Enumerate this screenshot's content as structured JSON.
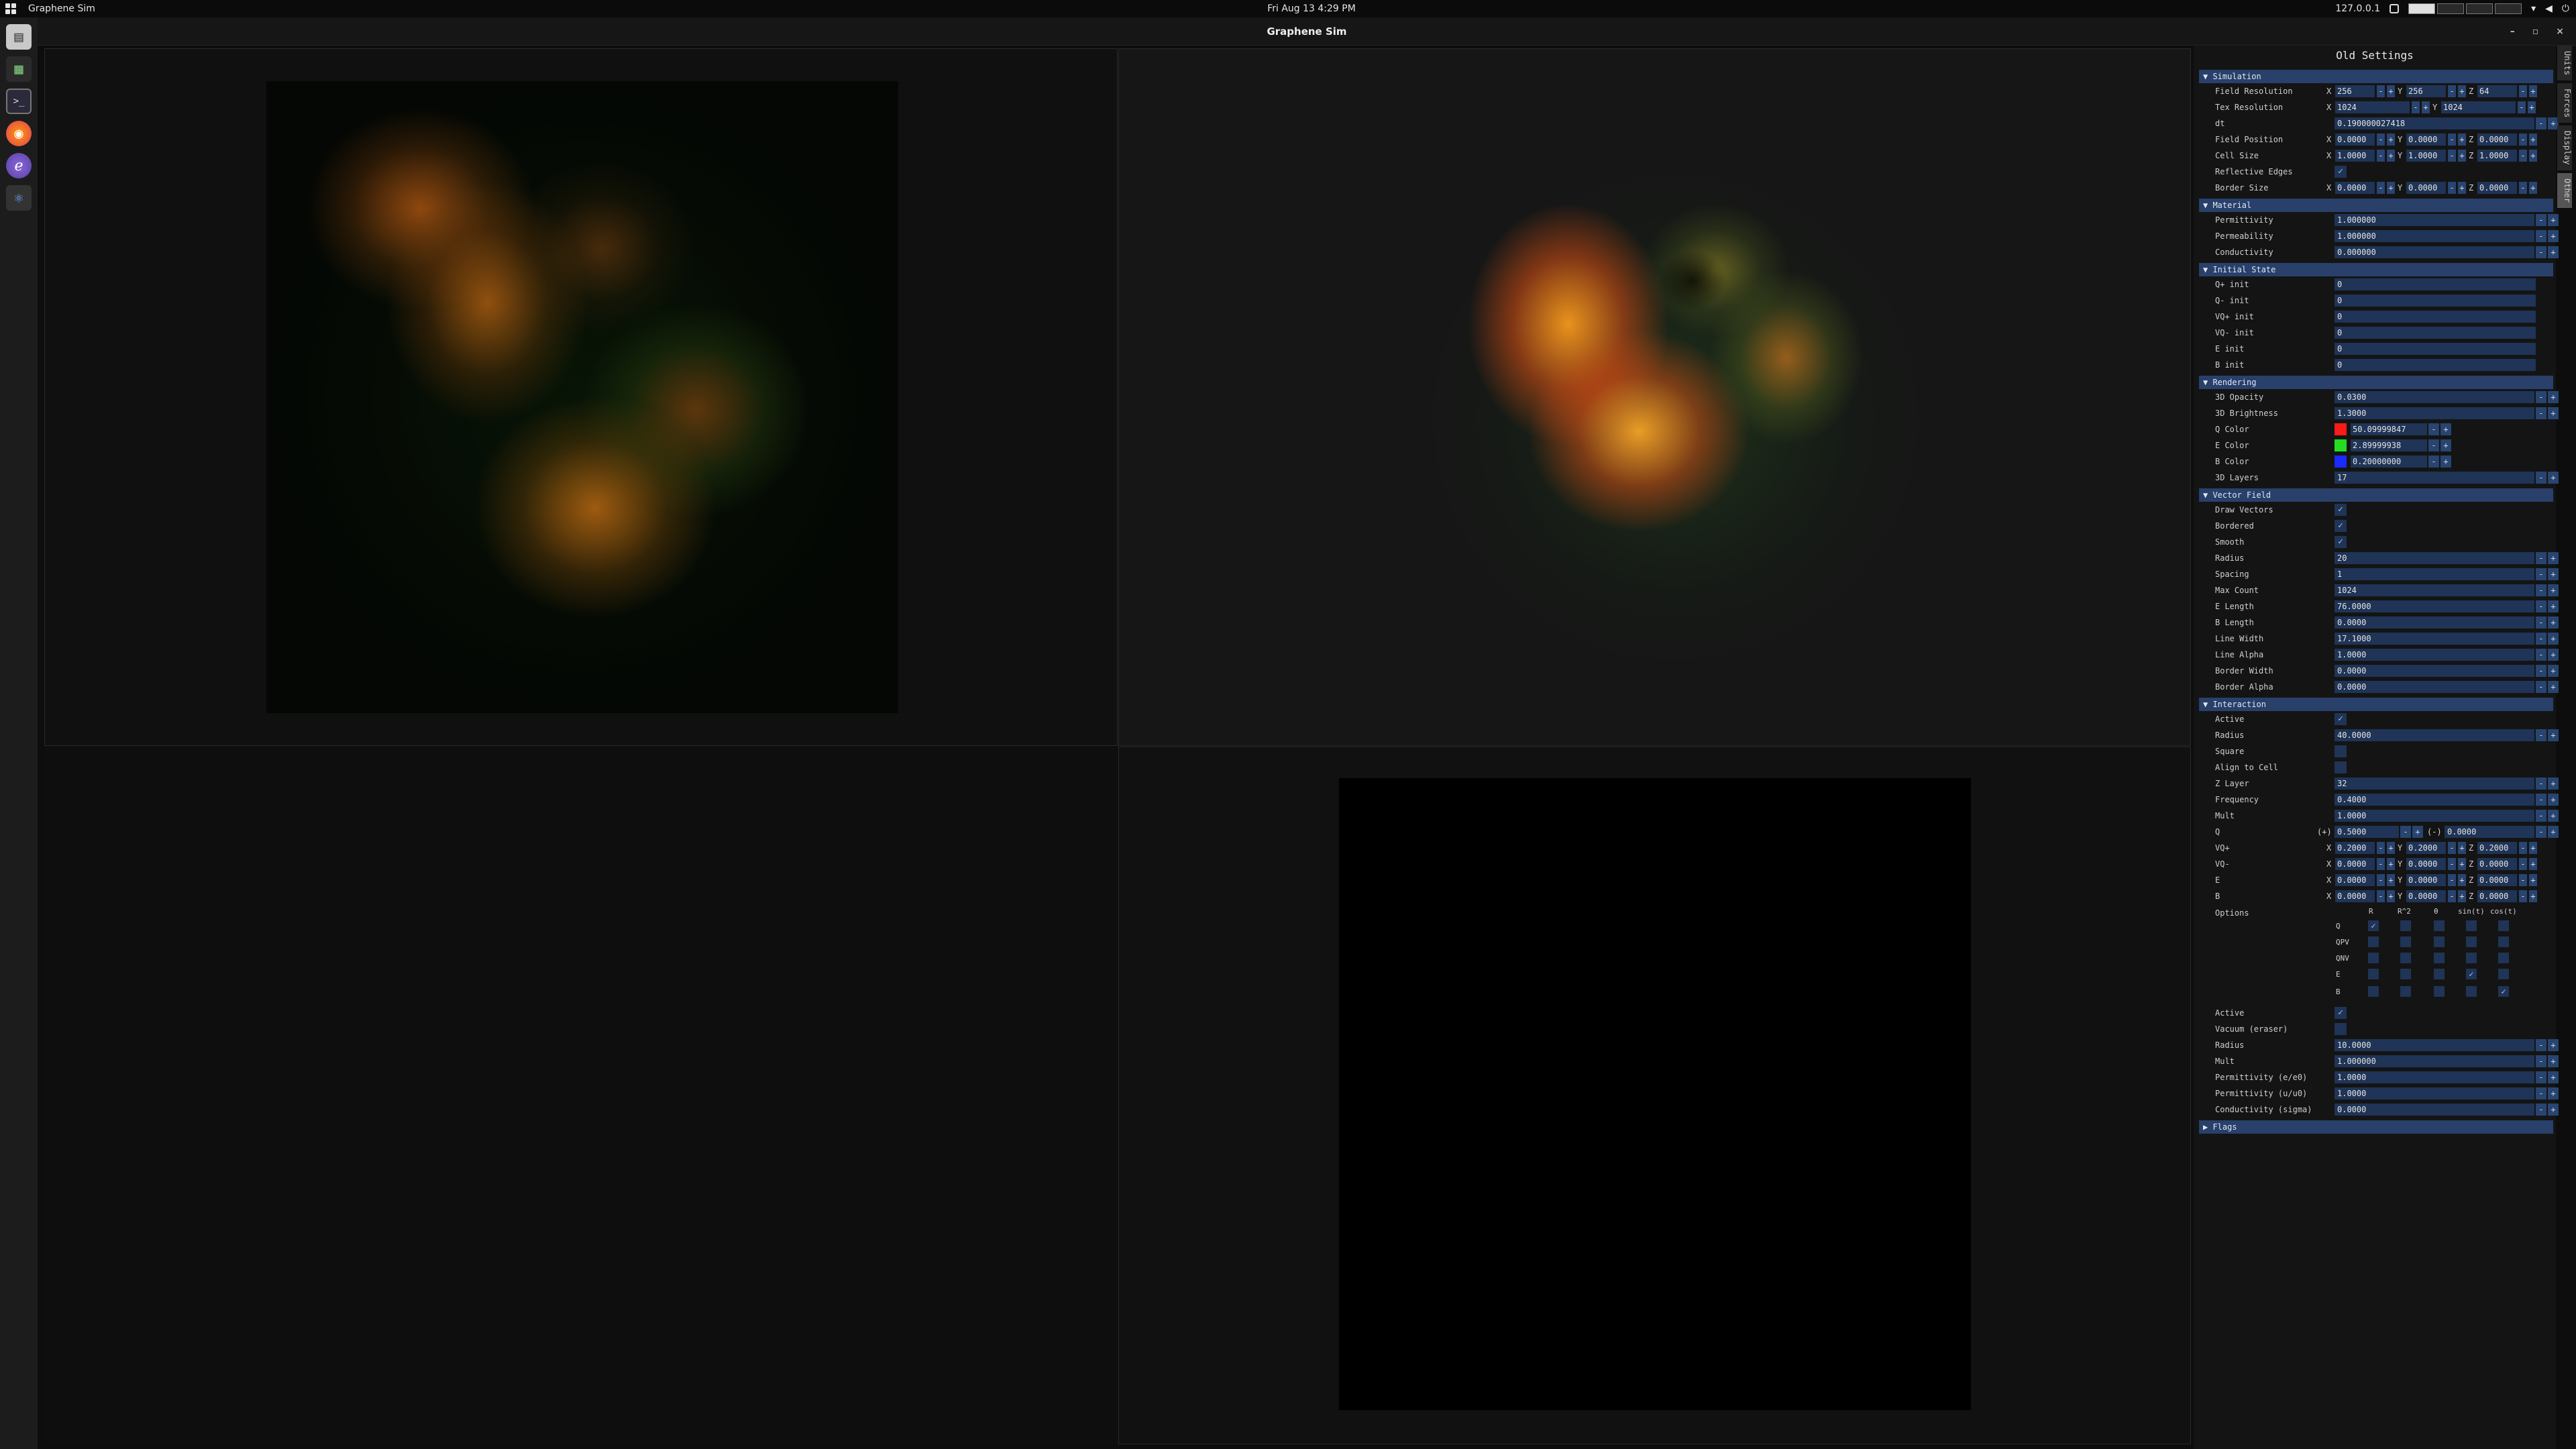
{
  "topbar": {
    "app_name": "Graphene Sim",
    "clock": "Fri Aug 13   4:29 PM",
    "ip": "127.0.0.1"
  },
  "window": {
    "title": "Graphene Sim",
    "controls": [
      "–",
      "▫",
      "×"
    ]
  },
  "dock": {
    "items": [
      {
        "icon": "files-icon",
        "glyph": "▤"
      },
      {
        "icon": "spreadsheet-icon",
        "glyph": "▦"
      },
      {
        "icon": "terminal-icon",
        "glyph": ">_"
      },
      {
        "icon": "firefox-icon",
        "glyph": "◉"
      },
      {
        "icon": "emacs-icon",
        "glyph": "ℯ"
      },
      {
        "icon": "graphene-sim-icon",
        "glyph": "⚛"
      }
    ]
  },
  "side_tabs": [
    "Units",
    "Forces",
    "Display",
    "Other"
  ],
  "panel": {
    "title": "Old Settings",
    "sections": {
      "simulation": "Simulation",
      "material": "Material",
      "initial_state": "Initial State",
      "rendering": "Rendering",
      "vector_field": "Vector Field",
      "interaction": "Interaction",
      "flags": "Flags"
    },
    "simulation": {
      "field_resolution": {
        "label": "Field Resolution",
        "x": "256",
        "y": "256",
        "z": "64"
      },
      "tex_resolution": {
        "label": "Tex Resolution",
        "x": "1024",
        "y": "1024"
      },
      "dt": {
        "label": "dt",
        "value": "0.190000027418"
      },
      "field_position": {
        "label": "Field Position",
        "x": "0.0000",
        "y": "0.0000",
        "z": "0.0000"
      },
      "cell_size": {
        "label": "Cell Size",
        "x": "1.0000",
        "y": "1.0000",
        "z": "1.0000"
      },
      "reflective_edges": {
        "label": "Reflective Edges",
        "checked": "✓"
      },
      "border_size": {
        "label": "Border Size",
        "x": "0.0000",
        "y": "0.0000",
        "z": "0.0000"
      }
    },
    "material": {
      "permittivity": {
        "label": "Permittivity",
        "value": "1.000000"
      },
      "permeability": {
        "label": "Permeability",
        "value": "1.000000"
      },
      "conductivity": {
        "label": "Conductivity",
        "value": "0.000000"
      }
    },
    "initial_state": [
      {
        "label": "Q+ init",
        "value": "0"
      },
      {
        "label": "Q- init",
        "value": "0"
      },
      {
        "label": "VQ+ init",
        "value": "0"
      },
      {
        "label": "VQ- init",
        "value": "0"
      },
      {
        "label": "E init",
        "value": "0"
      },
      {
        "label": "B init",
        "value": "0"
      }
    ],
    "rendering": {
      "opacity": {
        "label": "3D Opacity",
        "value": "0.0300"
      },
      "brightness": {
        "label": "3D Brightness",
        "value": "1.3000"
      },
      "q_color": {
        "label": "Q Color",
        "value": "50.09999847",
        "color": "#ff1a1a"
      },
      "e_color": {
        "label": "E Color",
        "value": "2.89999938",
        "color": "#22dd22"
      },
      "b_color": {
        "label": "B Color",
        "value": "0.20000000",
        "color": "#1a2aff"
      },
      "layers": {
        "label": "3D Layers",
        "value": "17"
      }
    },
    "vector_field": [
      {
        "label": "Draw Vectors",
        "check": "✓"
      },
      {
        "label": "Bordered",
        "check": "✓"
      },
      {
        "label": "Smooth",
        "check": "✓"
      },
      {
        "label": "Radius",
        "value": "20"
      },
      {
        "label": "Spacing",
        "value": "1"
      },
      {
        "label": "Max Count",
        "value": "1024"
      },
      {
        "label": "E Length",
        "value": "76.0000"
      },
      {
        "label": "B Length",
        "value": "0.0000"
      },
      {
        "label": "Line Width",
        "value": "17.1000"
      },
      {
        "label": "Line Alpha",
        "value": "1.0000"
      },
      {
        "label": "Border Width",
        "value": "0.0000"
      },
      {
        "label": "Border Alpha",
        "value": "0.0000"
      }
    ],
    "interaction": {
      "active": {
        "label": "Active",
        "check": "✓"
      },
      "radius": {
        "label": "Radius",
        "value": "40.0000"
      },
      "square": {
        "label": "Square",
        "check": ""
      },
      "align": {
        "label": "Align to Cell",
        "check": ""
      },
      "zlayer": {
        "label": "Z Layer",
        "value": "32"
      },
      "frequency": {
        "label": "Frequency",
        "value": "0.4000"
      },
      "mult": {
        "label": "Mult",
        "value": "1.0000"
      },
      "q": {
        "label": "Q",
        "plus_label": "(+)",
        "plus": "0.5000",
        "minus_label": "(-)",
        "minus": "0.0000"
      },
      "vqp": {
        "label": "VQ+",
        "x": "0.2000",
        "y": "0.2000",
        "z": "0.2000"
      },
      "vqn": {
        "label": "VQ-",
        "x": "0.0000",
        "y": "0.0000",
        "z": "0.0000"
      },
      "e": {
        "label": "E",
        "x": "0.0000",
        "y": "0.0000",
        "z": "0.0000"
      },
      "b": {
        "label": "B",
        "x": "0.0000",
        "y": "0.0000",
        "z": "0.0000"
      },
      "options": {
        "label": "Options",
        "columns": [
          "R",
          "R^2",
          "θ",
          "sin(t)",
          "cos(t)"
        ],
        "rows": [
          {
            "label": "Q",
            "checks": [
              "✓",
              "",
              "",
              "",
              ""
            ]
          },
          {
            "label": "QPV",
            "checks": [
              "",
              "",
              "",
              "",
              ""
            ]
          },
          {
            "label": "QNV",
            "checks": [
              "",
              "",
              "",
              "",
              ""
            ]
          },
          {
            "label": "E",
            "checks": [
              "",
              "",
              "",
              "✓",
              ""
            ]
          },
          {
            "label": "B",
            "checks": [
              "",
              "",
              "",
              "",
              "✓"
            ]
          }
        ]
      },
      "active2": {
        "label": "Active",
        "check": "✓"
      },
      "vacuum": {
        "label": "Vacuum (eraser)",
        "check": ""
      },
      "radius2": {
        "label": "Radius",
        "value": "10.0000"
      },
      "mult2": {
        "label": "Mult",
        "value": "1.000000"
      },
      "perm_e": {
        "label": "Permittivity (e/e0)",
        "value": "1.0000"
      },
      "perm_u": {
        "label": "Permittivity (u/u0)",
        "value": "1.0000"
      },
      "cond": {
        "label": "Conductivity (sigma)",
        "value": "0.0000"
      }
    }
  }
}
